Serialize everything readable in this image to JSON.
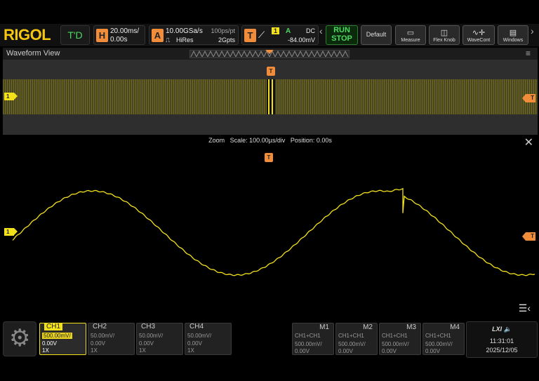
{
  "brand": "RIGOL",
  "header": {
    "mode_label": "T'D",
    "horizontal": {
      "badge": "H",
      "timebase": "20.00ms/",
      "offset": "0.00s"
    },
    "acquire": {
      "badge": "A",
      "sample_rate": "10.00GSa/s",
      "mode": "HiRes",
      "resolution": "100ps/pt",
      "depth": "2Gpts"
    },
    "trigger": {
      "badge": "T",
      "source": "1",
      "status": "A",
      "coupling": "DC",
      "level": "-84.00mV"
    },
    "run_stop": {
      "run": "RUN",
      "stop": "STOP"
    },
    "buttons": [
      {
        "label": "Default",
        "icon": "default-icon"
      },
      {
        "label": "Measure",
        "icon": "ruler-icon"
      },
      {
        "label": "Flex Knob",
        "icon": "knob-icon"
      },
      {
        "label": "WaveCont",
        "icon": "wave-icon"
      },
      {
        "label": "Windows",
        "icon": "windows-icon"
      }
    ]
  },
  "waveform_view": {
    "title": "Waveform View",
    "zoom": {
      "label": "Zoom",
      "scale": "Scale: 100.00µs/div",
      "position": "Position: 0.00s"
    },
    "ch_marker": "1",
    "trig_marker": "T"
  },
  "channels": [
    {
      "name": "CH1",
      "scale": "500.00mV/",
      "offset": "0.00V",
      "probe": "1X",
      "active": true
    },
    {
      "name": "CH2",
      "scale": "50.00mV/",
      "offset": "0.00V",
      "probe": "1X",
      "active": false
    },
    {
      "name": "CH3",
      "scale": "50.00mV/",
      "offset": "0.00V",
      "probe": "1X",
      "active": false
    },
    {
      "name": "CH4",
      "scale": "50.00mV/",
      "offset": "0.00V",
      "probe": "1X",
      "active": false
    }
  ],
  "math": [
    {
      "name": "M1",
      "expr": "CH1+CH1",
      "scale": "500.00mV/",
      "offset": "0.00V"
    },
    {
      "name": "M2",
      "expr": "CH1+CH1",
      "scale": "500.00mV/",
      "offset": "0.00V"
    },
    {
      "name": "M3",
      "expr": "CH1+CH1",
      "scale": "500.00mV/",
      "offset": "0.00V"
    },
    {
      "name": "M4",
      "expr": "CH1+CH1",
      "scale": "500.00mV/",
      "offset": "0.00V"
    }
  ],
  "status": {
    "lxi": "LXI",
    "time": "11:31:01",
    "date": "2025/12/05"
  },
  "colors": {
    "ch1": "#f3e11c",
    "trigger": "#f08c3a",
    "run": "#4cd964"
  }
}
